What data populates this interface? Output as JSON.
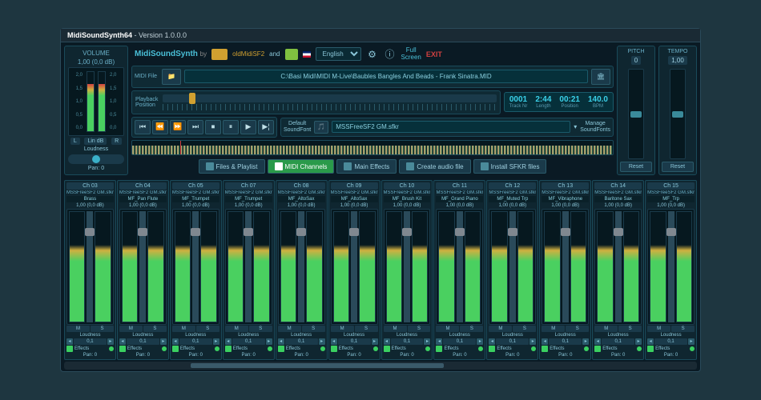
{
  "title": {
    "app": "MidiSoundSynth64",
    "version": "Version 1.0.0.0"
  },
  "header": {
    "app_name": "MidiSoundSynth",
    "by": "by",
    "brand1": "oldMidiSF2",
    "and": "and",
    "lang": "English",
    "full_screen": "Full\nScreen",
    "exit": "EXIT"
  },
  "volume": {
    "label": "VOLUME",
    "val": "1,00 (0,0 dB)",
    "scale": [
      "2,0",
      "1,5",
      "1,0",
      "0,5",
      "0,0"
    ],
    "L": "L",
    "R": "R",
    "lindb": "Lin dB",
    "loudness": "Loudness",
    "pan": "Pan: 0"
  },
  "file": {
    "label": "MIDI File",
    "path": "C:\\Basi Midi\\MIDI M-Live\\Baubles Bangles And Beads - Frank Sinatra.MID"
  },
  "playback": {
    "label": "Playback\nPosition"
  },
  "info": {
    "track": {
      "val": "0001",
      "lbl": "Track Nr"
    },
    "length": {
      "val": "2:44",
      "lbl": "Length"
    },
    "position": {
      "val": "00:21",
      "lbl": "Position"
    },
    "bpm": {
      "val": "140.0",
      "lbl": "BPM"
    }
  },
  "soundfont": {
    "label": "Default\nSoundFont",
    "name": "MSSFreeSF2 GM.sfkr",
    "manage": "Manage\nSoundFonts"
  },
  "tabs": {
    "files": "Files & Playlist",
    "channels": "MIDI Channels",
    "effects": "Main Effects",
    "audio": "Create audio file",
    "install": "Install SFKR files"
  },
  "pitch": {
    "label": "PITCH",
    "val": "0",
    "reset": "Reset"
  },
  "tempo": {
    "label": "TEMPO",
    "val": "1,00",
    "reset": "Reset"
  },
  "ch_common": {
    "sf": "MSSFreeSF2 GM.sfkr",
    "gain": "1,00 (0,0 dB)",
    "M": "M",
    "S": "S",
    "loudness": "Loudness",
    "spin": "0,1",
    "effects": "Effects",
    "pan": "Pan: 0"
  },
  "channels": [
    {
      "n": "Ch 03",
      "inst": "Brass"
    },
    {
      "n": "Ch 04",
      "inst": "MF_Pan Flute"
    },
    {
      "n": "Ch 05",
      "inst": "MF_Trumpet"
    },
    {
      "n": "Ch 07",
      "inst": "MF_Trumpet"
    },
    {
      "n": "Ch 08",
      "inst": "MF_AltoSax"
    },
    {
      "n": "Ch 09",
      "inst": "MF_AltoSax"
    },
    {
      "n": "Ch 10",
      "inst": "MF_Brush Kit"
    },
    {
      "n": "Ch 11",
      "inst": "MF_Grand Piano"
    },
    {
      "n": "Ch 12",
      "inst": "MF_Muted Trp"
    },
    {
      "n": "Ch 13",
      "inst": "MF_Vibraphone"
    },
    {
      "n": "Ch 14",
      "inst": "Baritone Sax"
    },
    {
      "n": "Ch 15",
      "inst": "MF_Trp"
    }
  ]
}
